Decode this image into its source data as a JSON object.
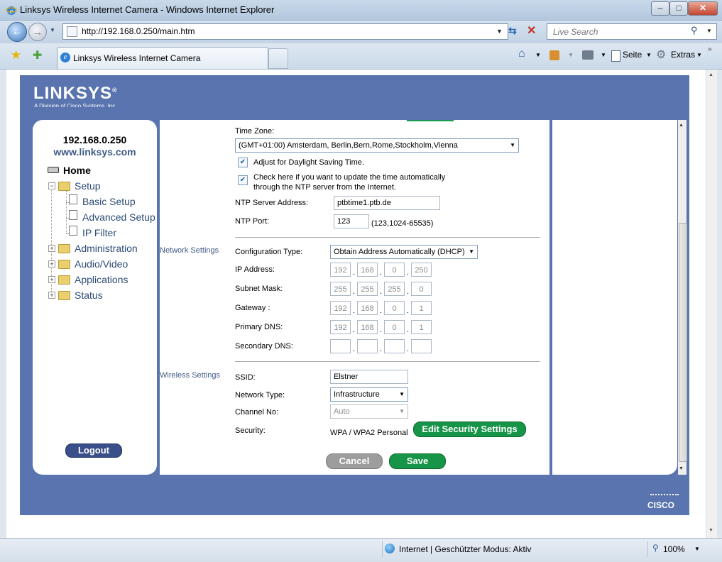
{
  "window": {
    "title": "Linksys Wireless Internet Camera - Windows Internet Explorer",
    "minimize": "‒",
    "maximize": "□",
    "close": "✕"
  },
  "address_bar": {
    "url": "http://192.168.0.250/main.htm",
    "search_placeholder": "Live Search"
  },
  "tabs": [
    {
      "label": "Linksys Wireless Internet Camera",
      "active": true
    }
  ],
  "toolbar": {
    "page_label": "Seite",
    "extras_label": "Extras"
  },
  "brand": {
    "logo": "LINKSYS",
    "logo_mark": "®",
    "tagline": "A Division of Cisco Systems, Inc.",
    "footer_logo": "CISCO",
    "accent": "#5974ae"
  },
  "sidebar": {
    "ip": "192.168.0.250",
    "site": "www.linksys.com",
    "items": [
      {
        "label": "Home"
      },
      {
        "label": "Setup"
      },
      {
        "label": "Basic Setup"
      },
      {
        "label": "Advanced Setup"
      },
      {
        "label": "IP Filter"
      },
      {
        "label": "Administration"
      },
      {
        "label": "Audio/Video"
      },
      {
        "label": "Applications"
      },
      {
        "label": "Status"
      }
    ],
    "logout_label": "Logout"
  },
  "time": {
    "zone_label": "Time Zone:",
    "zone_value": "(GMT+01:00) Amsterdam, Berlin,Bern,Rome,Stockholm,Vienna",
    "dst_label": "Adjust for Daylight Saving Time.",
    "dst_checked": true,
    "ntp_auto_label_line1": "Check here if you want to update the time automatically",
    "ntp_auto_label_line2": "through the NTP server from the Internet.",
    "ntp_auto_checked": true,
    "ntp_server_label": "NTP Server Address:",
    "ntp_server_value": "ptbtime1.ptb.de",
    "ntp_port_label": "NTP Port:",
    "ntp_port_value": "123",
    "ntp_port_hint": "(123,1024-65535)"
  },
  "network": {
    "section_label": "Network Settings",
    "config_label": "Configuration Type:",
    "config_value": "Obtain Address Automatically (DHCP)",
    "ip_label": "IP Address:",
    "ip": [
      "192",
      "168",
      "0",
      "250"
    ],
    "mask_label": "Subnet Mask:",
    "mask": [
      "255",
      "255",
      "255",
      "0"
    ],
    "gateway_label": "Gateway :",
    "gateway": [
      "192",
      "168",
      "0",
      "1"
    ],
    "dns1_label": "Primary DNS:",
    "dns1": [
      "192",
      "168",
      "0",
      "1"
    ],
    "dns2_label": "Secondary DNS:",
    "dns2": [
      "",
      "",
      "",
      ""
    ]
  },
  "wireless": {
    "section_label": "Wireless Settings",
    "ssid_label": "SSID:",
    "ssid_value": "Elstner",
    "type_label": "Network Type:",
    "type_value": "Infrastructure",
    "channel_label": "Channel No:",
    "channel_value": "Auto",
    "security_label": "Security:",
    "security_value": "WPA / WPA2 Personal",
    "edit_security_label": "Edit Security Settings"
  },
  "actions": {
    "cancel_label": "Cancel",
    "save_label": "Save"
  },
  "status_bar": {
    "zone": "Internet | Geschützter Modus: Aktiv",
    "zoom": "100%"
  }
}
